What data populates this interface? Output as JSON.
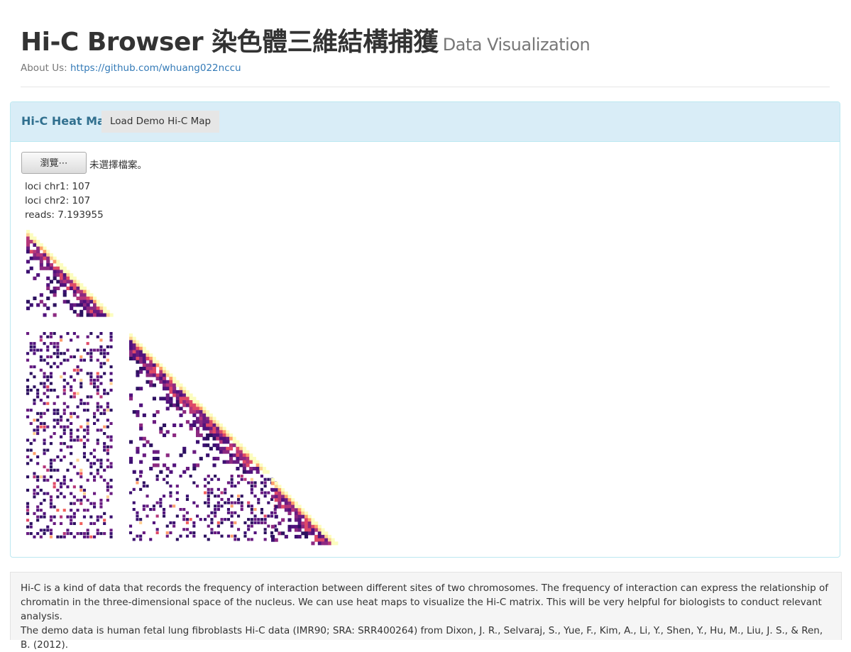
{
  "header": {
    "title": "Hi-C Browser 染色體三維結構捕獲",
    "subtitle": "Data Visualization",
    "about_label": "About Us:",
    "about_link": "https://github.com/whuang022nccu"
  },
  "panel": {
    "title": "Hi-C Heat Map",
    "demo_button": "Load Demo Hi-C Map",
    "browse_button": "瀏覽⋯",
    "file_status": "未選擇檔案。",
    "stats": {
      "chr1": "loci chr1: 107",
      "chr2": "loci chr2: 107",
      "reads": "reads: 7.193955"
    }
  },
  "footer": {
    "paragraph1": "Hi-C is a kind of data that records the frequency of interaction between different sites of two chromosomes. The frequency of interaction can express the relationship of chromatin in the three-dimensional space of the nucleus. We can use heat maps to visualize the Hi-C matrix. This will be very helpful for biologists to conduct relevant analysis.",
    "paragraph2": "The demo data is human fetal lung fibroblasts Hi-C data (IMR90; SRA: SRR400264) from Dixon, J. R., Selvaraj, S., Yue, F., Kim, A., Li, Y., Shen, Y., Hu, M., Liu, J. S., & Ren, B. (2012)."
  },
  "colors": {
    "heat_low": "#2d1160",
    "heat_mid": "#b5367a",
    "heat_high": "#fcfdbf",
    "link": "#337ab7",
    "panel_heading": "#d9edf7"
  }
}
